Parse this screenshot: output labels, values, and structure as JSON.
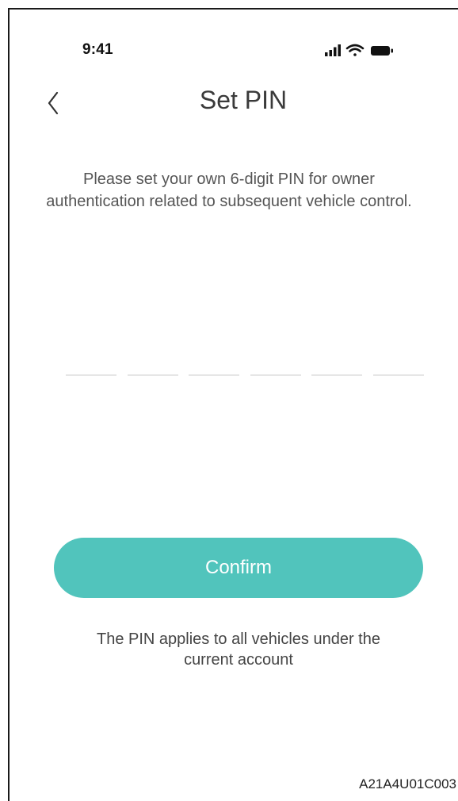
{
  "status_bar": {
    "time": "9:41",
    "icons": [
      "cellular-signal-icon",
      "wifi-icon",
      "battery-icon"
    ]
  },
  "header": {
    "back_icon": "chevron-left-icon",
    "title": "Set PIN"
  },
  "description": "Please set your own 6-digit PIN for owner authentication related to subsequent vehicle control.",
  "pin_input": {
    "length": 6,
    "digits": [
      "",
      "",
      "",
      "",
      "",
      ""
    ]
  },
  "confirm_button": {
    "label": "Confirm"
  },
  "footnote": "The PIN applies to all vehicles under the current account",
  "figure_code": "A21A4U01C003",
  "colors": {
    "accent": "#51c4bc",
    "title_text": "#3a3a3a",
    "body_text": "#555555",
    "pin_slot": "#e6e6e6"
  }
}
